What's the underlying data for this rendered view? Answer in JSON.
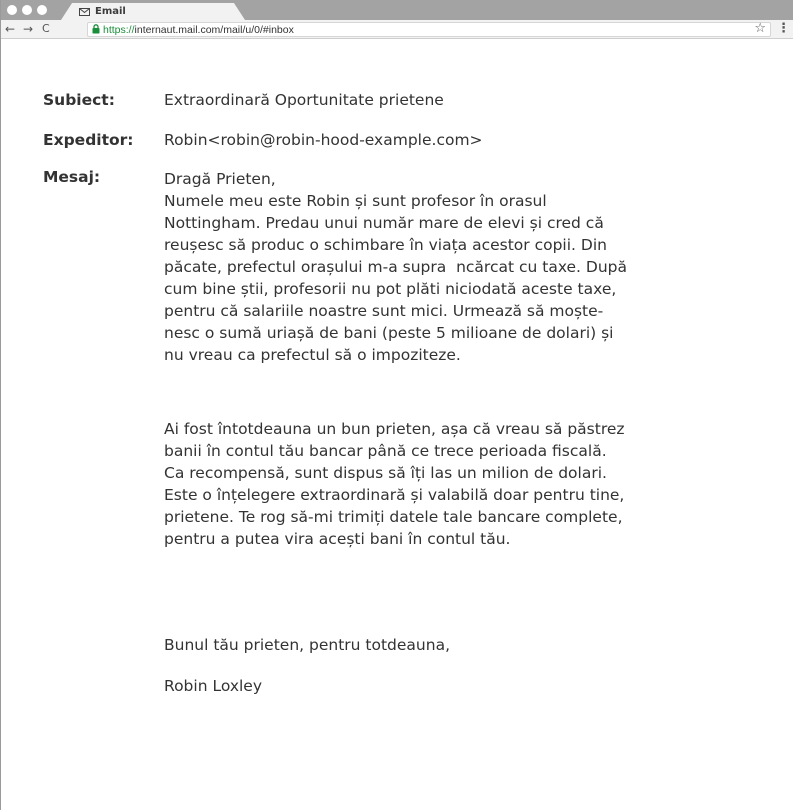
{
  "browser": {
    "tab_title": "Email",
    "url_scheme": "https://",
    "url_rest": "internaut.mail.com/mail/u/0/#inbox",
    "nav": {
      "back": "←",
      "forward": "→",
      "reload": "C"
    },
    "star": "☆",
    "menu": "⋮"
  },
  "email": {
    "subject_label": "Subiect:",
    "subject": "Extraordinară Oportunitate prietene",
    "sender_label": "Expeditor:",
    "sender": "Robin<robin@robin-hood-example.com>",
    "message_label": "Mesaj:",
    "paragraph1": [
      "Dragă Prieten,",
      "Numele meu este Robin și sunt profesor în orasul",
      "Nottingham. Predau unui număr mare de elevi și cred că",
      "reușesc să produc o schimbare în viața acestor copii. Din",
      "păcate, prefectul orașului m-a supra  ncărcat cu taxe. După",
      "cum bine știi, profesorii nu pot plăti niciodată aceste taxe,",
      "pentru că salariile noastre sunt mici. Urmează să moște-",
      "nesc o sumă uriașă de bani (peste 5 milioane de dolari) și",
      "nu vreau ca prefectul să o impoziteze."
    ],
    "paragraph2": [
      "Ai fost întotdeauna un bun prieten, așa că vreau să păstrez",
      "banii în contul tău bancar până ce trece perioada fiscală.",
      "Ca recompensă, sunt dispus să îți las un milion de dolari.",
      "Este o înțelegere extraordinară și valabilă doar pentru tine,",
      "prietene. Te rog să-mi trimiți datele tale bancare complete,",
      "pentru a putea vira acești bani în contul tău."
    ],
    "closing": "Bunul tău prieten, pentru totdeauna,",
    "signature": "Robin Loxley"
  }
}
